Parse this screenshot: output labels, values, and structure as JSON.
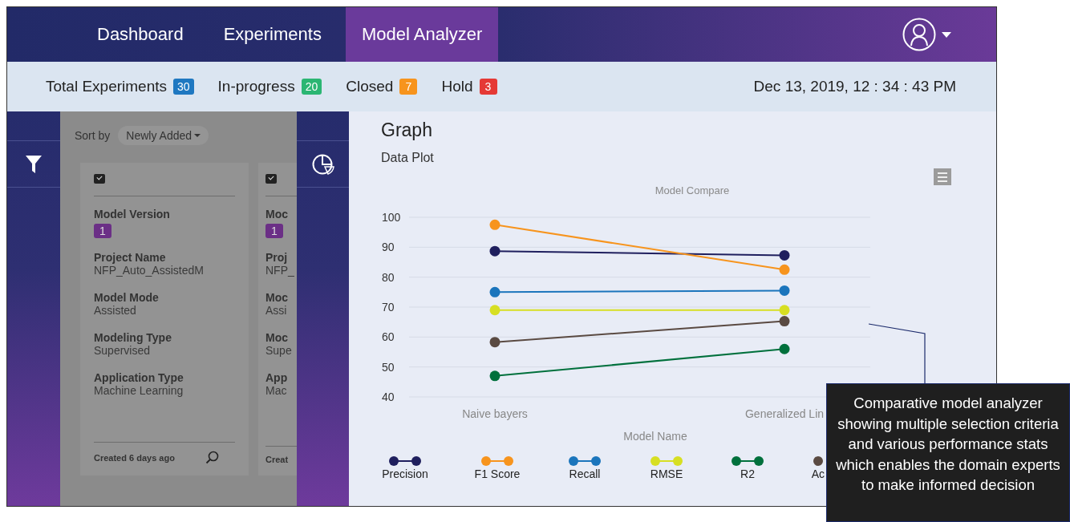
{
  "nav": {
    "tabs": [
      {
        "label": "Dashboard",
        "selected": false
      },
      {
        "label": "Experiments",
        "selected": false
      },
      {
        "label": "Model Analyzer",
        "selected": true
      }
    ]
  },
  "stats": [
    {
      "label": "Total Experiments",
      "count": "30",
      "color": "#1f78c1"
    },
    {
      "label": "In-progress",
      "count": "20",
      "color": "#2bb673"
    },
    {
      "label": "Closed",
      "count": "7",
      "color": "#f7941d"
    },
    {
      "label": "Hold",
      "count": "3",
      "color": "#e53935"
    }
  ],
  "datetime": "Dec 13, 2019, 12 : 34 : 43 PM",
  "sort": {
    "label": "Sort by",
    "value": "Newly Added"
  },
  "cards": [
    {
      "kind": "full",
      "checked": true,
      "version_label": "Model Version",
      "version": "1",
      "fields": [
        {
          "label": "Project Name",
          "value": "NFP_Auto_AssistedM"
        },
        {
          "label": "Model Mode",
          "value": "Assisted"
        },
        {
          "label": "Modeling Type",
          "value": "Supervised"
        },
        {
          "label": "Application Type",
          "value": "Machine Learning"
        }
      ],
      "created": "Created 6 days ago"
    },
    {
      "kind": "clipped",
      "checked": true,
      "version_label": "Moc",
      "version": "1",
      "fields": [
        {
          "label": "Proj",
          "value": "NFP_"
        },
        {
          "label": "Moc",
          "value": "Assi"
        },
        {
          "label": "Moc",
          "value": "Supe"
        },
        {
          "label": "App",
          "value": "Mac"
        }
      ],
      "created": "Creat"
    }
  ],
  "graph": {
    "title": "Graph",
    "subtitle": "Data Plot",
    "chart_data": {
      "type": "line",
      "title": "Model Compare",
      "xlabel": "Model Name",
      "categories": [
        "Naive bayers",
        "Generalized Lin"
      ],
      "ylim": [
        40,
        100
      ],
      "yticks": [
        40,
        50,
        60,
        70,
        80,
        90,
        100
      ],
      "grid": true,
      "legend": true,
      "series": [
        {
          "name": "Precision",
          "color": "#1f1f5e",
          "marker": "circle",
          "values": [
            88.7,
            87.3
          ]
        },
        {
          "name": "F1 Score",
          "color": "#f7941d",
          "marker": "circle",
          "values": [
            97.5,
            82.5
          ]
        },
        {
          "name": "Recall",
          "color": "#1b75bc",
          "marker": "circle",
          "values": [
            75,
            75.5
          ]
        },
        {
          "name": "RMSE",
          "color": "#d7df23",
          "marker": "circle",
          "values": [
            69,
            69
          ]
        },
        {
          "name": "R2",
          "color": "#00703c",
          "marker": "circle",
          "values": [
            47,
            56
          ]
        },
        {
          "name": "Ac",
          "color": "#5a4a42",
          "marker": "circle",
          "values": [
            58.3,
            65.3
          ]
        }
      ]
    }
  },
  "callout": "Comparative model analyzer showing multiple selection criteria and various performance stats which enables the domain experts to make informed decision"
}
